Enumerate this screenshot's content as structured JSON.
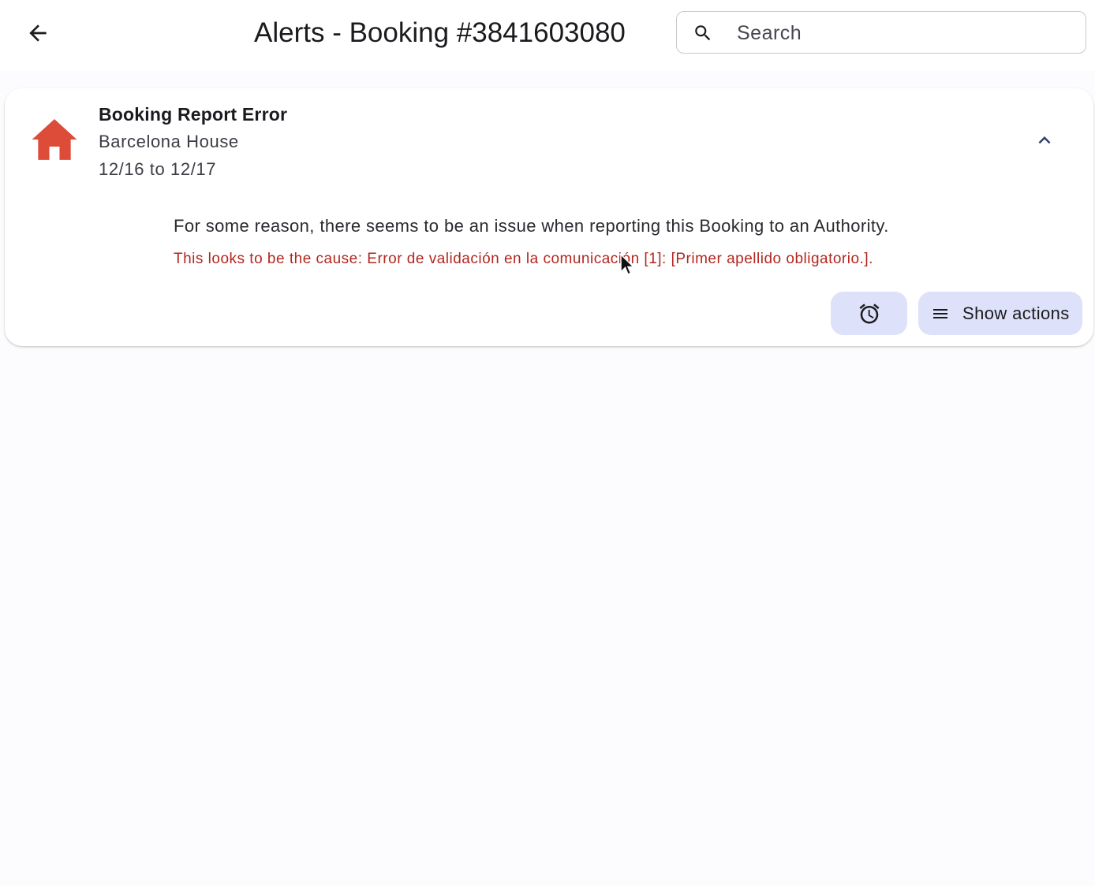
{
  "header": {
    "title": "Alerts - Booking #3841603080",
    "back_icon": "arrow-left-icon"
  },
  "search": {
    "placeholder": "Search",
    "value": "",
    "icon": "search-icon"
  },
  "alert": {
    "icon": "home-icon",
    "icon_color": "#dd4b39",
    "title": "Booking Report Error",
    "property": "Barcelona House",
    "dates": "12/16 to 12/17",
    "message": "For some reason, there seems to be an issue when reporting this Booking to an Authority.",
    "cause": "This looks to be the cause: Error de validación en la comunicación [1]: [Primer apellido obligatorio.].",
    "cause_color": "#b3261e",
    "expanded": true,
    "collapse_icon": "chevron-up-icon"
  },
  "actions": {
    "snooze_icon": "alarm-clock-icon",
    "show_actions_label": "Show actions",
    "menu_icon": "menu-icon",
    "button_color": "#dde1f9"
  }
}
